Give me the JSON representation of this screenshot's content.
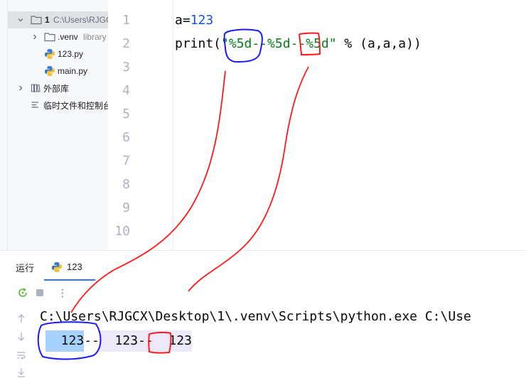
{
  "project_tree": {
    "root": {
      "label": "1",
      "path": "C:\\Users\\RJGC"
    },
    "venv": {
      "label": ".venv",
      "suffix": "library"
    },
    "files": [
      "123.py",
      "main.py"
    ],
    "external_libs": "外部库",
    "scratches": "临时文件和控制台"
  },
  "editor": {
    "line_numbers": [
      "1",
      "2",
      "3",
      "4",
      "5",
      "6",
      "7",
      "8",
      "9",
      "10"
    ],
    "line1": {
      "var": "a=",
      "num": "123"
    },
    "line2": {
      "fn": "print(",
      "str": "\"%5d--%5d--%5d\"",
      "rest": " % (a,a,a))"
    }
  },
  "run_panel": {
    "title": "运行",
    "tab_label": "123"
  },
  "console": {
    "command": "C:\\Users\\RJGCX\\Desktop\\1\\.venv\\Scripts\\python.exe C:\\Use",
    "output_segments": [
      "  123",
      "--",
      "  123",
      "--",
      "  123"
    ]
  },
  "colors": {
    "accent": "#3574f0",
    "annotation_blue": "#1a1aff",
    "annotation_red": "#ff1a1a"
  }
}
